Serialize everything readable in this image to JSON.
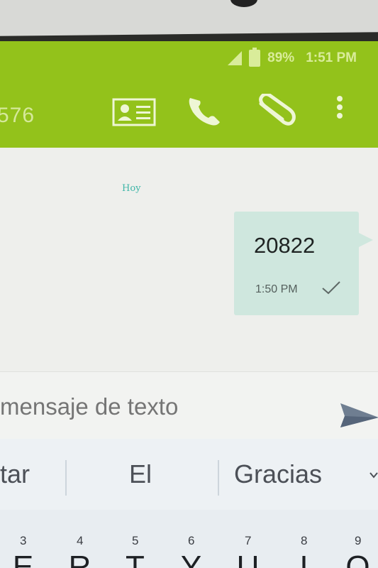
{
  "status_bar": {
    "battery": "89%",
    "time": "1:51 PM"
  },
  "app_bar": {
    "contact_partial": "576",
    "icons": [
      "contact-card-icon",
      "phone-icon",
      "paperclip-icon",
      "more-vert-icon"
    ]
  },
  "conversation": {
    "day_label": "Hoy",
    "messages": [
      {
        "text": "20822",
        "time": "1:50 PM",
        "status": "sent-check"
      }
    ]
  },
  "compose": {
    "placeholder": "mensaje de texto"
  },
  "keyboard": {
    "suggestions": [
      "tar",
      "El",
      "Gracias"
    ],
    "keys": [
      {
        "num": "3",
        "ch": "E"
      },
      {
        "num": "4",
        "ch": "R"
      },
      {
        "num": "5",
        "ch": "T"
      },
      {
        "num": "6",
        "ch": "Y"
      },
      {
        "num": "7",
        "ch": "U"
      },
      {
        "num": "8",
        "ch": "I"
      },
      {
        "num": "9",
        "ch": "O"
      }
    ]
  },
  "colors": {
    "app_bar": "#93c21b",
    "bubble": "#cfe7de",
    "accent_text": "#3fb6a8"
  }
}
